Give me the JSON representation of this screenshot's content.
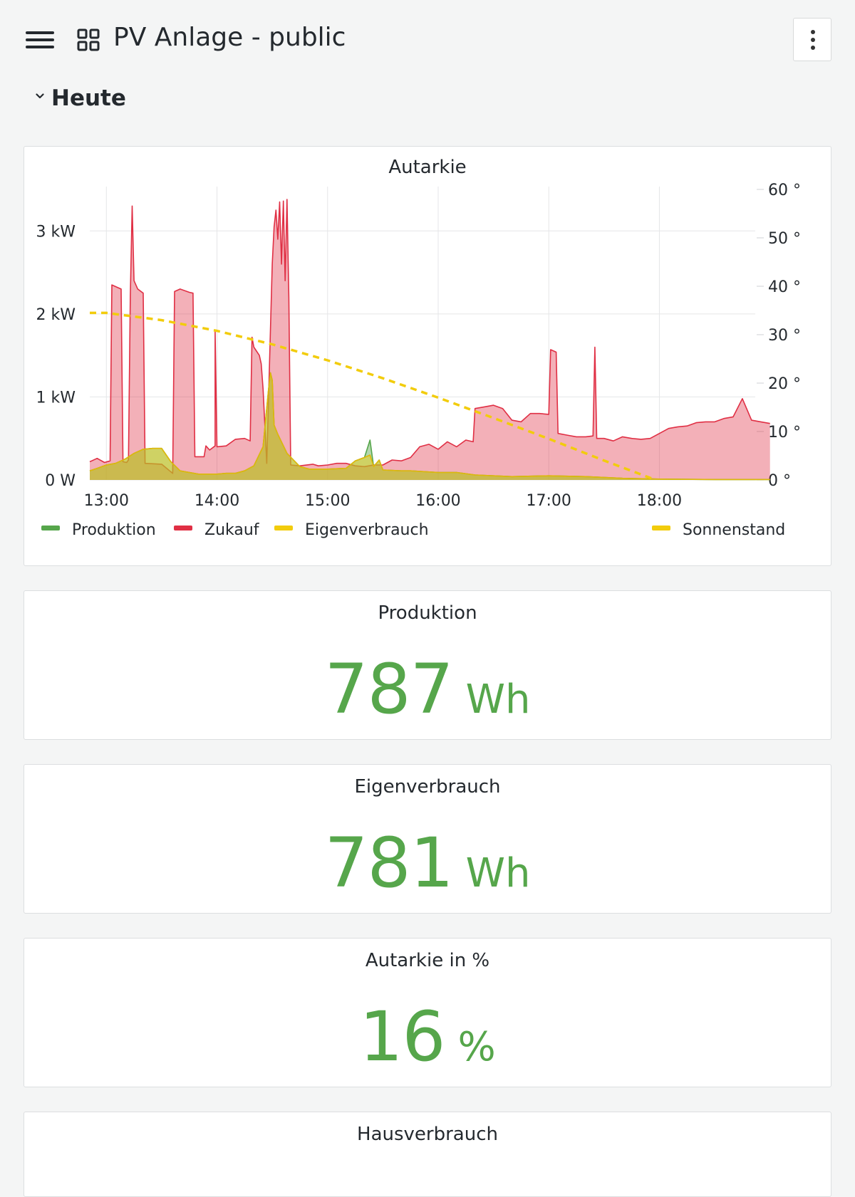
{
  "header": {
    "title": "PV Anlage - public",
    "menu_icon": "hamburger-menu-icon",
    "dashboard_icon": "dashboard-grid-icon",
    "more_icon": "kebab-vertical-icon"
  },
  "row": {
    "title": "Heute",
    "expanded": true
  },
  "colors": {
    "produktion": "#56a64b",
    "zukauf": "#e02f44",
    "eigenverbrauch": "#f2cc0c",
    "sonnenstand": "#f2cc0c",
    "stat_green": "#56a64b"
  },
  "chart_panel": {
    "title": "Autarkie"
  },
  "chart_data": {
    "type": "area",
    "title": "Autarkie",
    "xlabel": "",
    "ylabel": "",
    "x_ticks": [
      "13:00",
      "14:00",
      "15:00",
      "16:00",
      "17:00",
      "18:00"
    ],
    "y_ticks_left": [
      "0 W",
      "1 kW",
      "2 kW",
      "3 kW"
    ],
    "y_ticks_right": [
      "0 °",
      "10 °",
      "20 °",
      "30 °",
      "40 °",
      "50 °",
      "60 °"
    ],
    "ylim_left_w": [
      0,
      3500
    ],
    "ylim_right_deg": [
      0,
      60
    ],
    "grid": true,
    "legend_placement": "bottom",
    "legend": [
      {
        "name": "Produktion",
        "color": "#56a64b"
      },
      {
        "name": "Zukauf",
        "color": "#e02f44"
      },
      {
        "name": "Eigenverbrauch",
        "color": "#f2cc0c"
      },
      {
        "name": "Sonnenstand",
        "color": "#f2cc0c",
        "axis": "right",
        "style": "dashed"
      }
    ],
    "series": [
      {
        "name": "Zukauf",
        "axis": "left",
        "unit": "W",
        "points": [
          [
            "12:51",
            220
          ],
          [
            "12:55",
            260
          ],
          [
            "12:59",
            210
          ],
          [
            "13:02",
            230
          ],
          [
            "13:03",
            2350
          ],
          [
            "13:06",
            2320
          ],
          [
            "13:08",
            2300
          ],
          [
            "13:09",
            220
          ],
          [
            "13:11",
            210
          ],
          [
            "13:12",
            240
          ],
          [
            "13:13",
            2220
          ],
          [
            "13:14",
            3300
          ],
          [
            "13:15",
            2400
          ],
          [
            "13:17",
            2300
          ],
          [
            "13:20",
            2250
          ],
          [
            "13:21",
            200
          ],
          [
            "13:30",
            190
          ],
          [
            "13:36",
            80
          ],
          [
            "13:37",
            2270
          ],
          [
            "13:40",
            2300
          ],
          [
            "13:45",
            2260
          ],
          [
            "13:47",
            2250
          ],
          [
            "13:48",
            280
          ],
          [
            "13:53",
            280
          ],
          [
            "13:54",
            410
          ],
          [
            "13:56",
            360
          ],
          [
            "13:59",
            410
          ],
          [
            "13:59",
            1800
          ],
          [
            "14:00",
            400
          ],
          [
            "14:05",
            410
          ],
          [
            "14:10",
            490
          ],
          [
            "14:15",
            500
          ],
          [
            "14:18",
            470
          ],
          [
            "14:19",
            1720
          ],
          [
            "14:20",
            1600
          ],
          [
            "14:23",
            1500
          ],
          [
            "14:24",
            1400
          ],
          [
            "14:25",
            1100
          ],
          [
            "14:27",
            200
          ],
          [
            "14:30",
            2600
          ],
          [
            "14:31",
            3050
          ],
          [
            "14:32",
            3250
          ],
          [
            "14:33",
            2900
          ],
          [
            "14:34",
            3350
          ],
          [
            "14:35",
            2600
          ],
          [
            "14:36",
            3360
          ],
          [
            "14:37",
            2400
          ],
          [
            "14:38",
            3380
          ],
          [
            "14:39",
            2200
          ],
          [
            "14:40",
            180
          ],
          [
            "14:45",
            170
          ],
          [
            "14:52",
            190
          ],
          [
            "14:55",
            170
          ],
          [
            "15:00",
            180
          ],
          [
            "15:05",
            200
          ],
          [
            "15:10",
            200
          ],
          [
            "15:15",
            170
          ],
          [
            "15:20",
            160
          ],
          [
            "15:25",
            180
          ],
          [
            "15:30",
            180
          ],
          [
            "15:35",
            240
          ],
          [
            "15:40",
            230
          ],
          [
            "15:45",
            270
          ],
          [
            "15:50",
            400
          ],
          [
            "15:55",
            430
          ],
          [
            "16:00",
            370
          ],
          [
            "16:05",
            460
          ],
          [
            "16:10",
            400
          ],
          [
            "16:15",
            480
          ],
          [
            "16:19",
            460
          ],
          [
            "16:20",
            860
          ],
          [
            "16:25",
            880
          ],
          [
            "16:30",
            900
          ],
          [
            "16:35",
            860
          ],
          [
            "16:40",
            720
          ],
          [
            "16:45",
            700
          ],
          [
            "16:50",
            800
          ],
          [
            "16:55",
            800
          ],
          [
            "17:00",
            790
          ],
          [
            "17:01",
            1570
          ],
          [
            "17:04",
            1540
          ],
          [
            "17:05",
            560
          ],
          [
            "17:10",
            540
          ],
          [
            "17:15",
            520
          ],
          [
            "17:20",
            520
          ],
          [
            "17:24",
            530
          ],
          [
            "17:25",
            1600
          ],
          [
            "17:26",
            500
          ],
          [
            "17:30",
            500
          ],
          [
            "17:35",
            470
          ],
          [
            "17:40",
            520
          ],
          [
            "17:45",
            500
          ],
          [
            "17:50",
            490
          ],
          [
            "17:55",
            500
          ],
          [
            "18:00",
            560
          ],
          [
            "18:05",
            620
          ],
          [
            "18:10",
            640
          ],
          [
            "18:15",
            650
          ],
          [
            "18:20",
            690
          ],
          [
            "18:25",
            700
          ],
          [
            "18:30",
            700
          ],
          [
            "18:35",
            740
          ],
          [
            "18:40",
            760
          ],
          [
            "18:45",
            980
          ],
          [
            "18:50",
            720
          ],
          [
            "18:55",
            700
          ],
          [
            "19:00",
            680
          ]
        ]
      },
      {
        "name": "Eigenverbrauch",
        "axis": "left",
        "unit": "W",
        "points": [
          [
            "12:51",
            110
          ],
          [
            "12:55",
            140
          ],
          [
            "13:00",
            180
          ],
          [
            "13:05",
            200
          ],
          [
            "13:10",
            250
          ],
          [
            "13:15",
            320
          ],
          [
            "13:20",
            370
          ],
          [
            "13:25",
            380
          ],
          [
            "13:30",
            380
          ],
          [
            "13:35",
            220
          ],
          [
            "13:40",
            110
          ],
          [
            "13:50",
            70
          ],
          [
            "14:00",
            70
          ],
          [
            "14:05",
            80
          ],
          [
            "14:10",
            80
          ],
          [
            "14:15",
            110
          ],
          [
            "14:20",
            170
          ],
          [
            "14:25",
            400
          ],
          [
            "14:28",
            1100
          ],
          [
            "14:29",
            1290
          ],
          [
            "14:30",
            1200
          ],
          [
            "14:31",
            660
          ],
          [
            "14:33",
            550
          ],
          [
            "14:38",
            320
          ],
          [
            "14:45",
            160
          ],
          [
            "14:50",
            130
          ],
          [
            "15:00",
            130
          ],
          [
            "15:10",
            140
          ],
          [
            "15:15",
            230
          ],
          [
            "15:20",
            270
          ],
          [
            "15:23",
            300
          ],
          [
            "15:25",
            160
          ],
          [
            "15:28",
            240
          ],
          [
            "15:30",
            120
          ],
          [
            "15:40",
            110
          ],
          [
            "15:45",
            110
          ],
          [
            "16:00",
            90
          ],
          [
            "16:10",
            90
          ],
          [
            "16:20",
            60
          ],
          [
            "16:40",
            40
          ],
          [
            "17:00",
            50
          ],
          [
            "17:20",
            40
          ],
          [
            "17:40",
            20
          ],
          [
            "18:00",
            10
          ],
          [
            "18:30",
            5
          ],
          [
            "19:00",
            5
          ]
        ]
      },
      {
        "name": "Produktion",
        "axis": "left",
        "unit": "W",
        "points": [
          [
            "12:51",
            110
          ],
          [
            "12:55",
            140
          ],
          [
            "13:00",
            180
          ],
          [
            "13:05",
            200
          ],
          [
            "13:10",
            250
          ],
          [
            "13:15",
            320
          ],
          [
            "13:20",
            370
          ],
          [
            "13:25",
            380
          ],
          [
            "13:30",
            380
          ],
          [
            "13:35",
            220
          ],
          [
            "13:40",
            110
          ],
          [
            "13:50",
            70
          ],
          [
            "14:00",
            70
          ],
          [
            "14:05",
            80
          ],
          [
            "14:10",
            80
          ],
          [
            "14:15",
            110
          ],
          [
            "14:20",
            170
          ],
          [
            "14:25",
            400
          ],
          [
            "14:28",
            1100
          ],
          [
            "14:29",
            1290
          ],
          [
            "14:30",
            1200
          ],
          [
            "14:31",
            660
          ],
          [
            "14:33",
            550
          ],
          [
            "14:38",
            320
          ],
          [
            "14:45",
            160
          ],
          [
            "14:50",
            130
          ],
          [
            "15:00",
            130
          ],
          [
            "15:10",
            140
          ],
          [
            "15:15",
            230
          ],
          [
            "15:20",
            270
          ],
          [
            "15:23",
            480
          ],
          [
            "15:25",
            160
          ],
          [
            "15:28",
            240
          ],
          [
            "15:30",
            120
          ],
          [
            "15:40",
            110
          ],
          [
            "15:45",
            110
          ],
          [
            "16:00",
            90
          ],
          [
            "16:10",
            90
          ],
          [
            "16:20",
            60
          ],
          [
            "16:40",
            40
          ],
          [
            "17:00",
            50
          ],
          [
            "17:20",
            40
          ],
          [
            "17:40",
            20
          ],
          [
            "18:00",
            10
          ],
          [
            "18:30",
            5
          ],
          [
            "19:00",
            5
          ]
        ]
      },
      {
        "name": "Sonnenstand",
        "axis": "right",
        "unit": "°",
        "points": [
          [
            "12:51",
            34.5
          ],
          [
            "13:00",
            34.5
          ],
          [
            "13:30",
            33.0
          ],
          [
            "14:00",
            30.8
          ],
          [
            "14:30",
            28.0
          ],
          [
            "15:00",
            24.7
          ],
          [
            "15:30",
            21.0
          ],
          [
            "16:00",
            17.0
          ],
          [
            "16:30",
            12.8
          ],
          [
            "17:00",
            8.5
          ],
          [
            "17:30",
            4.0
          ],
          [
            "17:58",
            0
          ]
        ]
      }
    ]
  },
  "stats": [
    {
      "title": "Produktion",
      "value": "787",
      "unit": "Wh"
    },
    {
      "title": "Eigenverbrauch",
      "value": "781",
      "unit": "Wh"
    },
    {
      "title": "Autarkie in %",
      "value": "16",
      "unit": "%"
    },
    {
      "title": "Hausverbrauch",
      "value": "",
      "unit": ""
    }
  ]
}
